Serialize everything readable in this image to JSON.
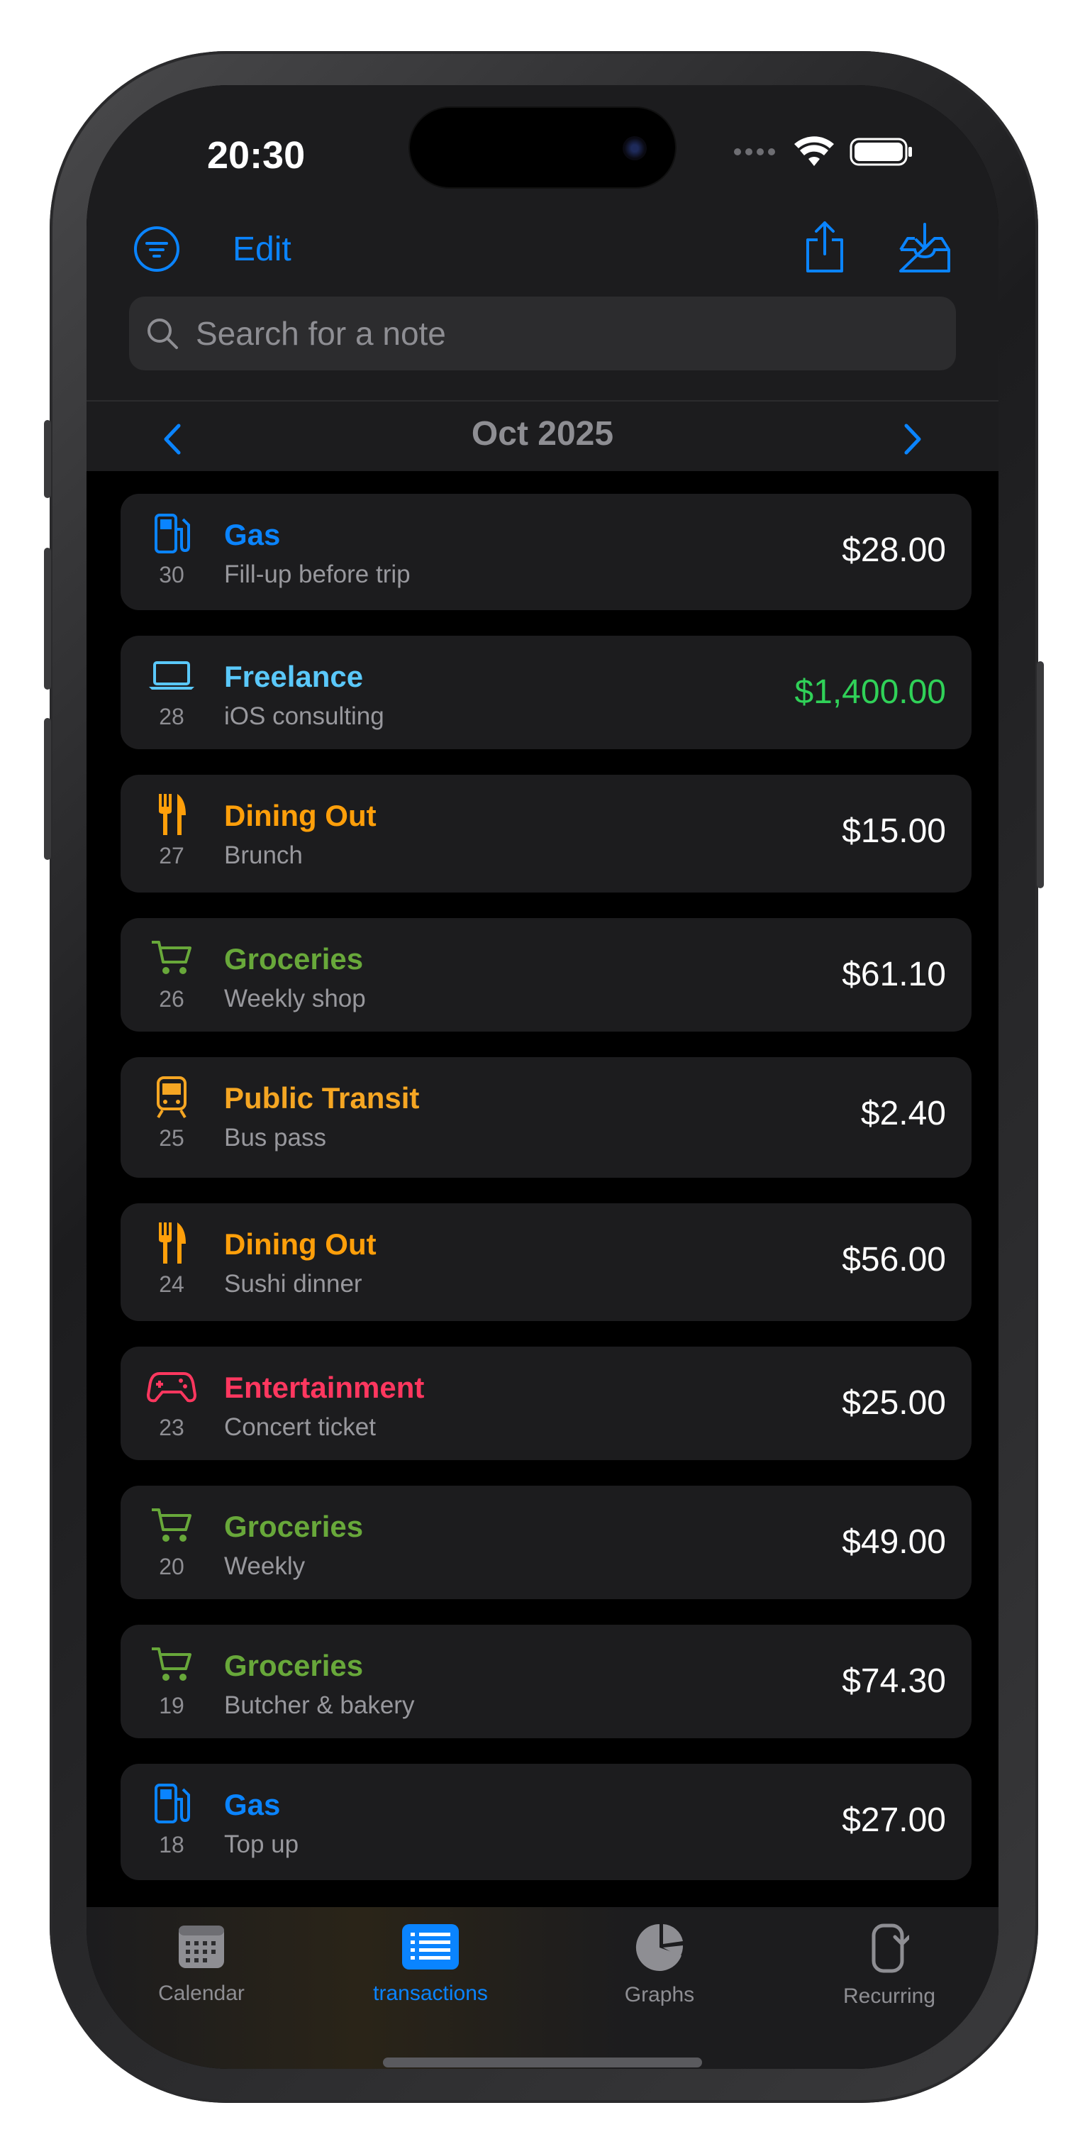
{
  "status": {
    "time": "20:30"
  },
  "toolbar": {
    "edit_label": "Edit"
  },
  "search": {
    "placeholder": "Search for a note"
  },
  "month": {
    "label": "Oct 2025"
  },
  "colors": {
    "blue": "#0a84ff",
    "cyan": "#5ac8fa",
    "orange": "#ff9f0a",
    "green": "#68a83a",
    "gold": "#f5a623",
    "pink": "#ff375f",
    "income": "#30d158"
  },
  "transactions": [
    {
      "category": "Gas",
      "note": "Fill-up before trip",
      "day": "30",
      "amount": "$28.00",
      "icon": "fuel-pump-icon",
      "color": "#0a84ff",
      "amount_color": "#ffffff"
    },
    {
      "category": "Freelance",
      "note": "iOS consulting",
      "day": "28",
      "amount": "$1,400.00",
      "icon": "laptop-icon",
      "color": "#5ac8fa",
      "amount_color": "#30d158"
    },
    {
      "category": "Dining Out",
      "note": "Brunch",
      "day": "27",
      "amount": "$15.00",
      "icon": "fork-knife-icon",
      "color": "#ff9f0a",
      "amount_color": "#ffffff"
    },
    {
      "category": "Groceries",
      "note": "Weekly shop",
      "day": "26",
      "amount": "$61.10",
      "icon": "cart-icon",
      "color": "#68a83a",
      "amount_color": "#ffffff"
    },
    {
      "category": "Public Transit",
      "note": "Bus pass",
      "day": "25",
      "amount": "$2.40",
      "icon": "tram-icon",
      "color": "#f5a623",
      "amount_color": "#ffffff"
    },
    {
      "category": "Dining Out",
      "note": "Sushi dinner",
      "day": "24",
      "amount": "$56.00",
      "icon": "fork-knife-icon",
      "color": "#ff9f0a",
      "amount_color": "#ffffff"
    },
    {
      "category": "Entertainment",
      "note": "Concert ticket",
      "day": "23",
      "amount": "$25.00",
      "icon": "gamepad-icon",
      "color": "#ff375f",
      "amount_color": "#ffffff"
    },
    {
      "category": "Groceries",
      "note": "Weekly",
      "day": "20",
      "amount": "$49.00",
      "icon": "cart-icon",
      "color": "#68a83a",
      "amount_color": "#ffffff"
    },
    {
      "category": "Groceries",
      "note": "Butcher & bakery",
      "day": "19",
      "amount": "$74.30",
      "icon": "cart-icon",
      "color": "#68a83a",
      "amount_color": "#ffffff"
    },
    {
      "category": "Gas",
      "note": "Top up",
      "day": "18",
      "amount": "$27.00",
      "icon": "fuel-pump-icon",
      "color": "#0a84ff",
      "amount_color": "#ffffff"
    }
  ],
  "tabs": [
    {
      "label": "Calendar",
      "icon": "calendar-icon",
      "active": false
    },
    {
      "label": "transactions",
      "icon": "list-icon",
      "active": true
    },
    {
      "label": "Graphs",
      "icon": "pie-chart-icon",
      "active": false
    },
    {
      "label": "Recurring",
      "icon": "recurring-icon",
      "active": false
    }
  ]
}
